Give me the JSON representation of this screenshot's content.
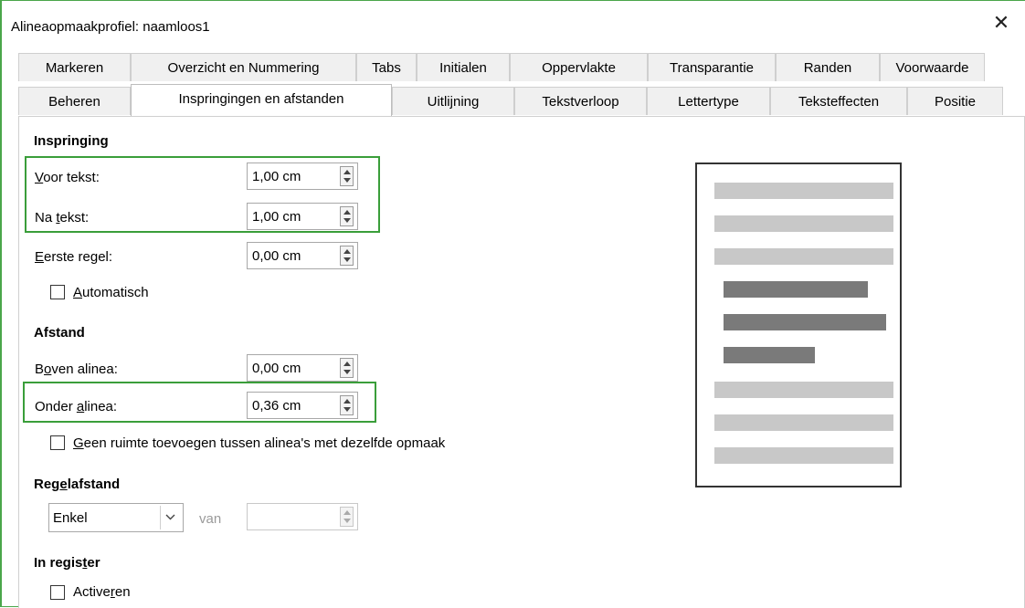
{
  "window": {
    "title": "Alineaopmaakprofiel: naamloos1",
    "close_symbol": "✕"
  },
  "tabs": {
    "row1": [
      "Markeren",
      "Overzicht en Nummering",
      "Tabs",
      "Initialen",
      "Oppervlakte",
      "Transparantie",
      "Randen",
      "Voorwaarde"
    ],
    "row2": [
      "Beheren",
      "Inspringingen en afstanden",
      "Uitlijning",
      "Tekstverloop",
      "Lettertype",
      "Teksteffecten",
      "Positie"
    ],
    "selected": "Inspringingen en afstanden"
  },
  "indent": {
    "heading": "Inspringing",
    "before_label": "Voor tekst:",
    "before_value": "1,00 cm",
    "after_label": "Na tekst:",
    "after_value": "1,00 cm",
    "first_label": "Eerste regel:",
    "first_value": "0,00 cm",
    "auto_label": "Automatisch",
    "auto_checked": false
  },
  "spacing": {
    "heading": "Afstand",
    "above_label": "Boven alinea:",
    "above_value": "0,00 cm",
    "below_label": "Onder alinea:",
    "below_value": "0,36 cm",
    "no_space_label": "Geen ruimte toevoegen tussen alinea's met dezelfde opmaak",
    "no_space_checked": false
  },
  "line_spacing": {
    "heading": "Regelafstand",
    "selected": "Enkel",
    "of_label": "van",
    "of_value": ""
  },
  "register": {
    "heading": "In register",
    "activate_label": "Activeren",
    "activate_checked": false
  },
  "colors": {
    "highlight": "#3a9e3a",
    "preview_light": "#c8c8c8",
    "preview_dark": "#7a7a7a"
  }
}
